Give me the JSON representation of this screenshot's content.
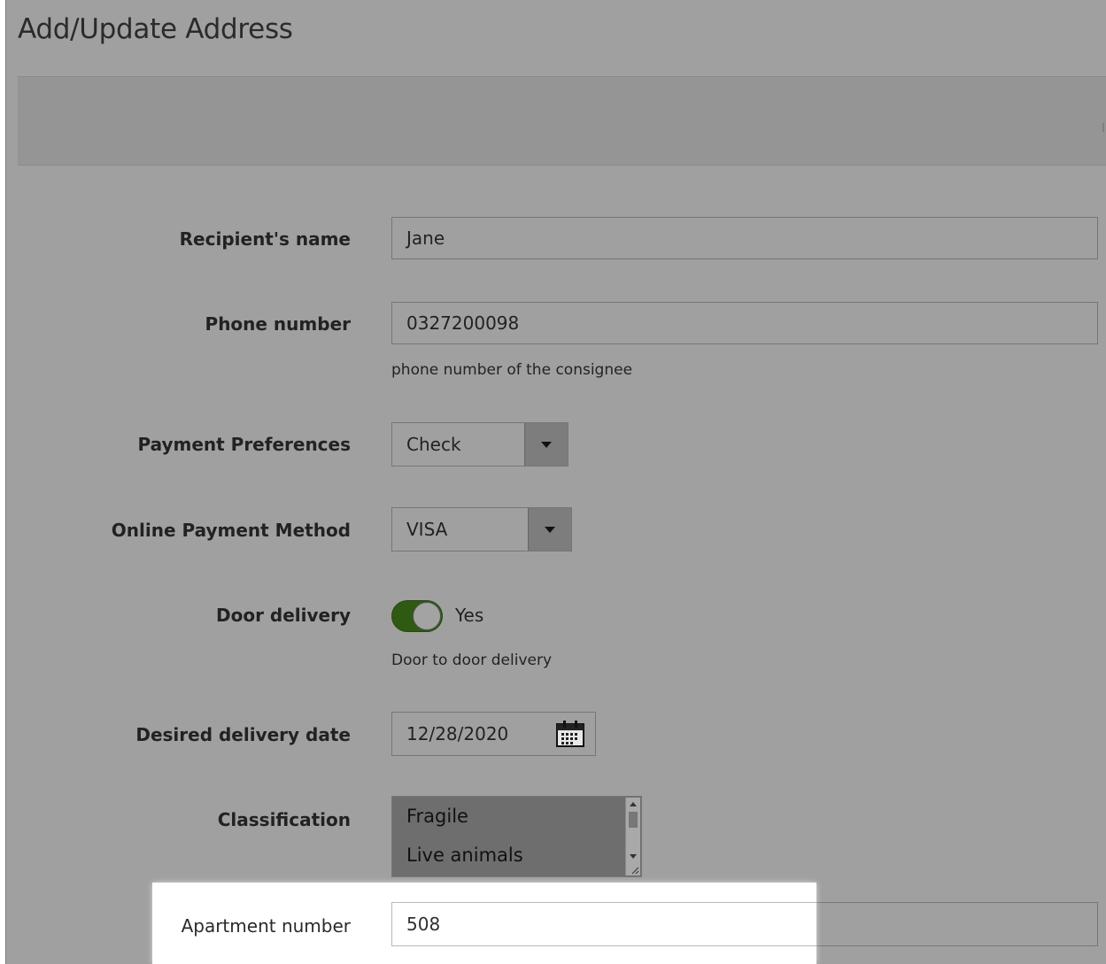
{
  "page": {
    "title": "Add/Update Address"
  },
  "form": {
    "recipient_name": {
      "label": "Recipient's name",
      "value": "Jane"
    },
    "phone_number": {
      "label": "Phone number",
      "value": "0327200098",
      "hint": "phone number of the consignee"
    },
    "payment_preferences": {
      "label": "Payment Preferences",
      "selected": "Check"
    },
    "online_payment_method": {
      "label": "Online Payment Method",
      "selected": "VISA"
    },
    "door_delivery": {
      "label": "Door delivery",
      "state_label": "Yes",
      "on": true,
      "hint": "Door to door delivery"
    },
    "desired_delivery_date": {
      "label": "Desired delivery date",
      "value": "12/28/2020",
      "icon": "calendar-icon"
    },
    "classification": {
      "label": "Classification",
      "options": [
        "Fragile",
        "Live animals"
      ]
    },
    "apartment_number": {
      "label": "Apartment number",
      "value": "508"
    }
  },
  "colors": {
    "toggle_on": "#2f5a12",
    "overlay": "#a0a0a0",
    "highlight": "#ffffff"
  }
}
